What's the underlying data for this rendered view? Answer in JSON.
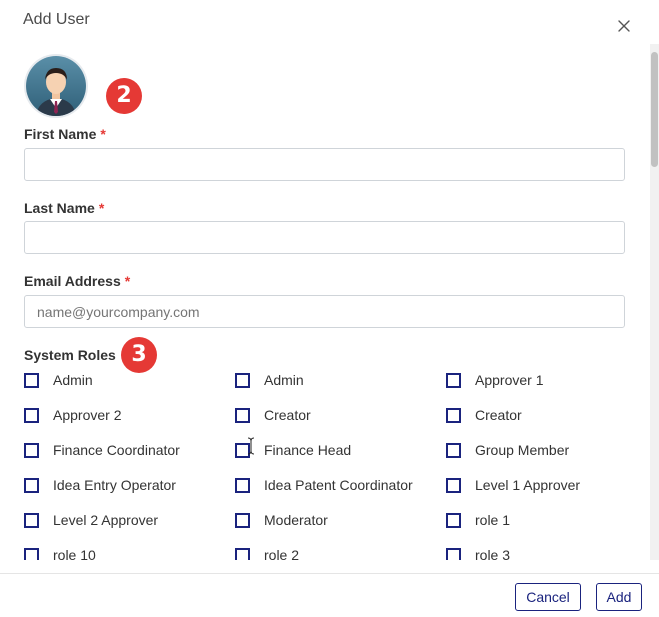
{
  "dialog": {
    "title": "Add User",
    "close_icon": "close-icon"
  },
  "avatar": {
    "icon": "user-avatar-icon"
  },
  "annotations": {
    "badge_avatar": "2",
    "badge_roles": "3"
  },
  "form": {
    "first_name": {
      "label": "First Name",
      "required": "*",
      "value": "",
      "placeholder": ""
    },
    "last_name": {
      "label": "Last Name",
      "required": "*",
      "value": "",
      "placeholder": ""
    },
    "email": {
      "label": "Email Address",
      "required": "*",
      "value": "",
      "placeholder": "name@yourcompany.com"
    }
  },
  "roles": {
    "label": "System Roles",
    "items": [
      {
        "label": "Admin",
        "checked": false
      },
      {
        "label": "Admin",
        "checked": false
      },
      {
        "label": "Approver 1",
        "checked": false
      },
      {
        "label": "Approver 2",
        "checked": false
      },
      {
        "label": "Creator",
        "checked": false
      },
      {
        "label": "Creator",
        "checked": false
      },
      {
        "label": "Finance Coordinator",
        "checked": false
      },
      {
        "label": "Finance Head",
        "checked": false
      },
      {
        "label": "Group Member",
        "checked": false
      },
      {
        "label": "Idea Entry Operator",
        "checked": false
      },
      {
        "label": "Idea Patent Coordinator",
        "checked": false
      },
      {
        "label": "Level 1 Approver",
        "checked": false
      },
      {
        "label": "Level 2 Approver",
        "checked": false
      },
      {
        "label": "Moderator",
        "checked": false
      },
      {
        "label": "role 1",
        "checked": false
      },
      {
        "label": "role 10",
        "checked": false
      },
      {
        "label": "role 2",
        "checked": false
      },
      {
        "label": "role 3",
        "checked": false
      }
    ]
  },
  "footer": {
    "cancel_label": "Cancel",
    "add_label": "Add"
  },
  "colors": {
    "accent": "#1a237e",
    "required": "#e53935",
    "badge": "#e53935",
    "border": "#cfd4d9"
  }
}
